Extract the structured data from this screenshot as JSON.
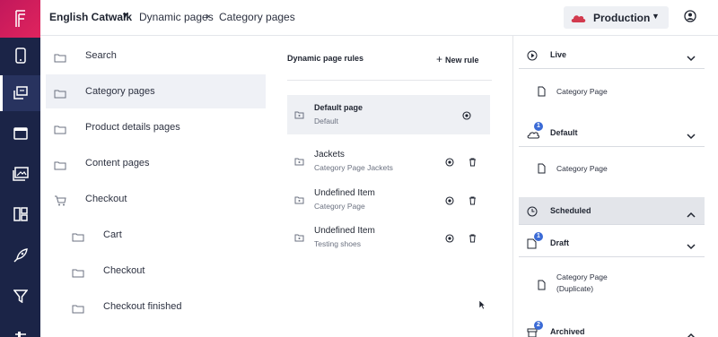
{
  "topbar": {
    "brand": "English Catwalk",
    "breadcrumb": [
      "Dynamic pages",
      "Category pages"
    ],
    "environment": "Production"
  },
  "sidebar_icons": [
    "logo-icon",
    "phone-icon",
    "pages-icon",
    "window-icon",
    "media-icon",
    "layout-icon",
    "rocket-icon",
    "filter-icon",
    "settings-icon"
  ],
  "page_list": {
    "items": [
      {
        "label": "Search"
      },
      {
        "label": "Category pages"
      },
      {
        "label": "Product details pages"
      },
      {
        "label": "Content pages"
      },
      {
        "label": "Checkout"
      },
      {
        "label": "Cart"
      },
      {
        "label": "Checkout"
      },
      {
        "label": "Checkout finished"
      }
    ]
  },
  "rules": {
    "title": "Dynamic page rules",
    "new_rule": "New rule",
    "items": [
      {
        "name": "Default page",
        "subtitle": "Default"
      },
      {
        "name": "Jackets",
        "subtitle": "Category Page Jackets"
      },
      {
        "name": "Undefined Item",
        "subtitle": "Category Page"
      },
      {
        "name": "Undefined Item",
        "subtitle": "Testing shoes"
      }
    ]
  },
  "versions": {
    "live": {
      "title": "Live",
      "entry": "Category Page"
    },
    "default": {
      "title": "Default",
      "badge": "1",
      "entry": "Category Page"
    },
    "scheduled": {
      "title": "Scheduled"
    },
    "draft": {
      "title": "Draft",
      "badge": "1",
      "entry_line1": "Category Page",
      "entry_line2": "(Duplicate)"
    },
    "archived": {
      "title": "Archived",
      "badge": "2"
    }
  },
  "colors": {
    "rail": "#1b2447",
    "brand_accent": "#e0245e",
    "selection": "#eff1f6",
    "badge": "#3b6bd6",
    "production_cloud": "#d23a4e"
  }
}
